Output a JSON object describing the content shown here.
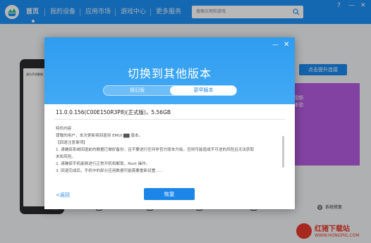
{
  "nav": {
    "items": [
      {
        "label": "首页",
        "active": true
      },
      {
        "label": "我的设备",
        "active": false
      },
      {
        "label": "应用市场",
        "active": false
      },
      {
        "label": "游戏中心",
        "active": false
      },
      {
        "label": "更多服务",
        "active": false
      }
    ],
    "search_placeholder": "搜索应用和游戏",
    "window_controls": {
      "help": "?",
      "minimize": "—",
      "close": "✕"
    }
  },
  "background": {
    "phone_screen_text": "请为手机解锁",
    "rescue_button": "点击提升连接",
    "purple_card_text": "视频\n体验",
    "repair_label": "系统修复"
  },
  "dialog": {
    "title": "切换到其他版本",
    "tabs": {
      "inactive": "换旧版",
      "active": "更早版本"
    },
    "version_line": "11.0.0.156(C00E150R3P8)(正式版)，5.56GB",
    "content_heading": "特色内容",
    "content_lines": [
      "尊敬的用户，本次更新将回退到 EMUI ▇▇ 版本。",
      "【回退注意事项】",
      "1. 请确保系统回退前的数据已做好备份，且不要进行任何非官方版本升级，否则可能造成不可逆的风险且无法获取",
      "未知风险。",
      "2. 请确保手机能够进行正常开机和解锁，Root 操作。",
      "3. 回退完成后，手机中的部分应用数据可能需要重新设置……"
    ],
    "back_link": "<返回",
    "restore_button": "恢复"
  },
  "watermark": {
    "name": "红猪下载站",
    "url": "WWW.HONGPIG.COM"
  },
  "colors": {
    "primary_blue": "#1c8ff5",
    "button_blue": "#1b86e8",
    "purple": "#b55ce0",
    "watermark_red": "#e8382b"
  }
}
